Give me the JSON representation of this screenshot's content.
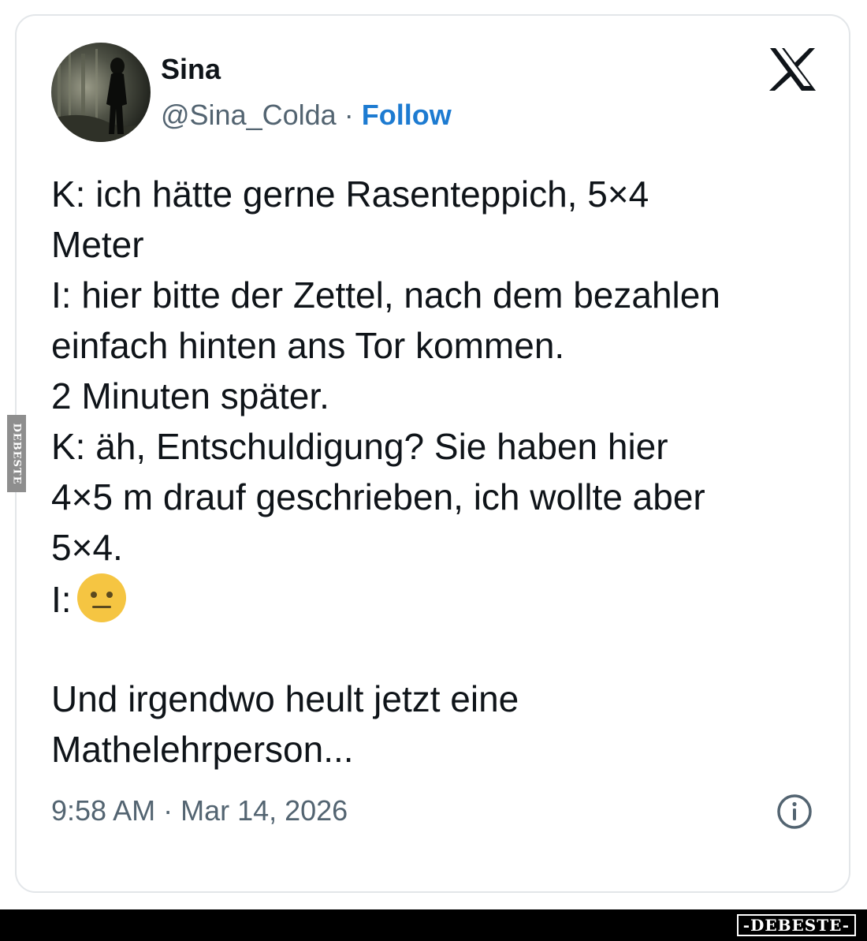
{
  "tweet": {
    "author": {
      "display_name": "Sina",
      "handle": "@Sina_Colda",
      "separator": "·",
      "follow_label": "Follow",
      "avatar_icon": "avatar-photo"
    },
    "platform_icon": "x-logo-icon",
    "text_lines": [
      "K: ich hätte gerne Rasenteppich, 5×4",
      "Meter",
      "I: hier bitte der Zettel, nach dem bezahlen",
      "einfach hinten ans Tor kommen.",
      "2 Minuten später.",
      "K: äh, Entschuldigung? Sie haben hier",
      "4×5 m drauf geschrieben, ich wollte aber",
      "5×4.",
      "I:",
      "Und irgendwo heult jetzt eine",
      "Mathelehrperson..."
    ],
    "emoji_icon": "neutral-face-emoji",
    "timestamp": "9:58 AM · Mar 14, 2026",
    "info_icon": "info-icon"
  },
  "watermark": {
    "side_text": "DEBESTE",
    "footer_text": "-DEBESTE-"
  },
  "colors": {
    "text": "#0f1419",
    "secondary": "#536471",
    "link": "#1d7bd1",
    "border": "#e3e6e9",
    "emoji": "#f5c542"
  }
}
